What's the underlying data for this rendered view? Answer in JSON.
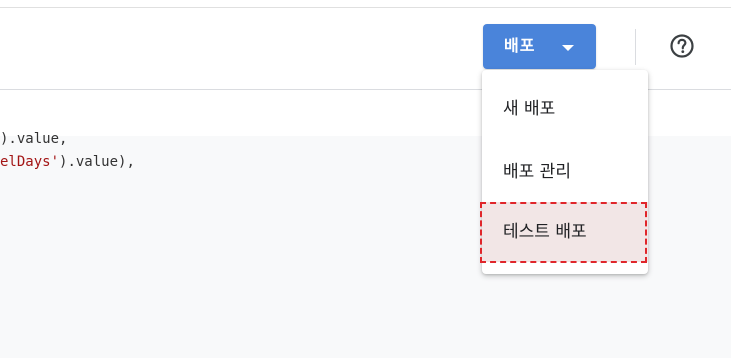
{
  "header": {
    "deploy_button_label": "배포",
    "help_icon": "help-circle-icon"
  },
  "code": {
    "line1_suffix": ").value,",
    "line2_string": "elDays'",
    "line2_suffix": ").value),"
  },
  "deploy_menu": {
    "items": [
      {
        "label": "새 배포"
      },
      {
        "label": "배포 관리"
      },
      {
        "label": "테스트 배포",
        "highlighted": true
      }
    ]
  },
  "colors": {
    "deploy_button": "#4a84da",
    "highlight_fill": "#f2e6e6",
    "highlight_border": "#e0262b",
    "code_string": "#a31515"
  }
}
